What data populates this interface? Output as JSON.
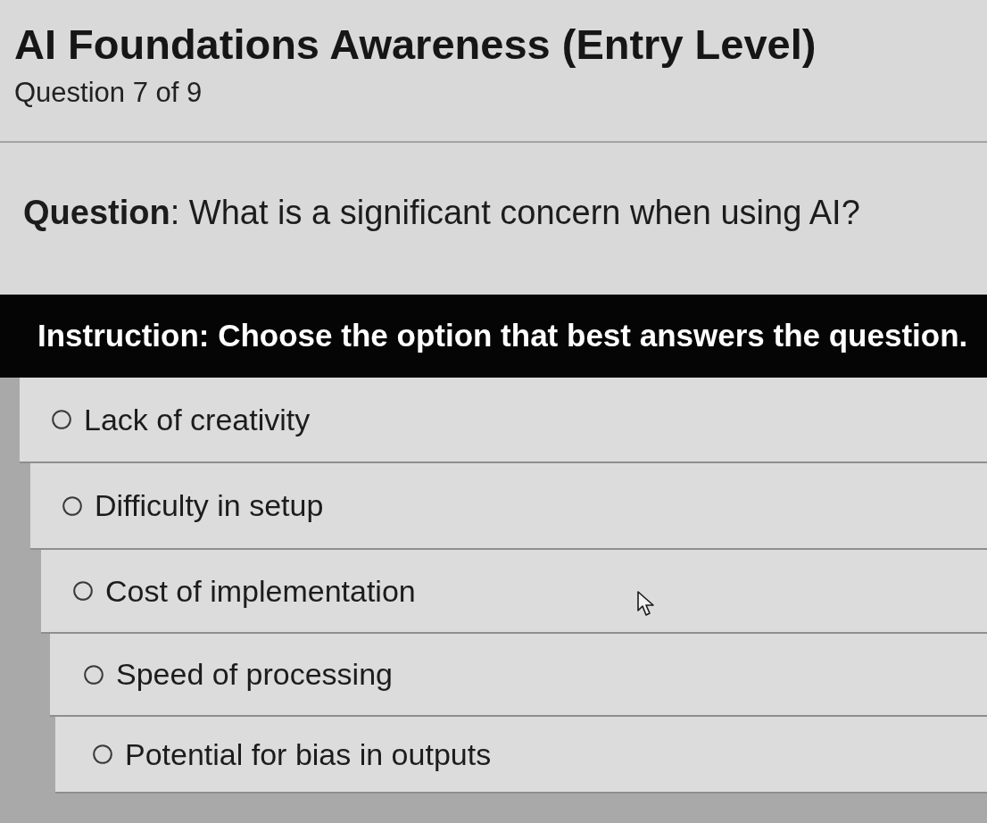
{
  "quiz": {
    "title": "AI Foundations Awareness (Entry Level)",
    "counter": "Question 7 of 9"
  },
  "question": {
    "text": "**Question**: What is a significant concern when using AI?"
  },
  "instruction": {
    "text": "Instruction: Choose the option that best answers the question."
  },
  "options": [
    {
      "label": "Lack of creativity",
      "selected": false
    },
    {
      "label": "Difficulty in setup",
      "selected": false
    },
    {
      "label": "Cost of implementation",
      "selected": false
    },
    {
      "label": "Speed of processing",
      "selected": false
    },
    {
      "label": "Potential for bias in outputs",
      "selected": false
    }
  ]
}
